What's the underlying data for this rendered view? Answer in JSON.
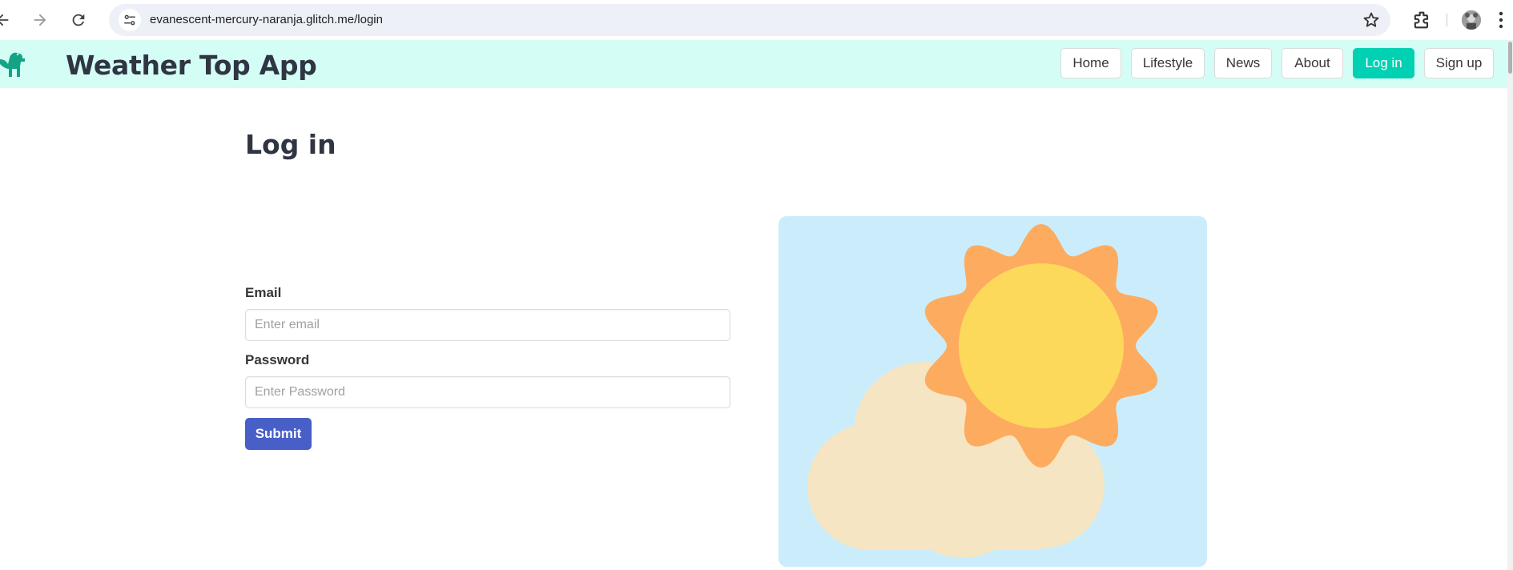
{
  "browser": {
    "url": "evanescent-mercury-naranja.glitch.me/login"
  },
  "site": {
    "brand": "Weather Top App",
    "nav": [
      {
        "label": "Home"
      },
      {
        "label": "Lifestyle"
      },
      {
        "label": "News"
      },
      {
        "label": "About"
      },
      {
        "label": "Log in",
        "active": true
      },
      {
        "label": "Sign up"
      }
    ]
  },
  "login": {
    "title": "Log in",
    "email_label": "Email",
    "email_placeholder": "Enter email",
    "email_value": "",
    "password_label": "Password",
    "password_placeholder": "Enter Password",
    "password_value": "",
    "submit_label": "Submit"
  },
  "colors": {
    "navbar_bg": "#d4fdf6",
    "accent": "#00d1b2",
    "submit": "#485fc7",
    "card_bg": "#cbedfb"
  },
  "icons": [
    "back-arrow-icon",
    "forward-arrow-icon",
    "reload-icon",
    "site-settings-icon",
    "bookmark-star-icon",
    "extensions-icon",
    "profile-avatar",
    "more-menu-icon",
    "brand-logo-icon",
    "sun-cloud-illustration"
  ]
}
